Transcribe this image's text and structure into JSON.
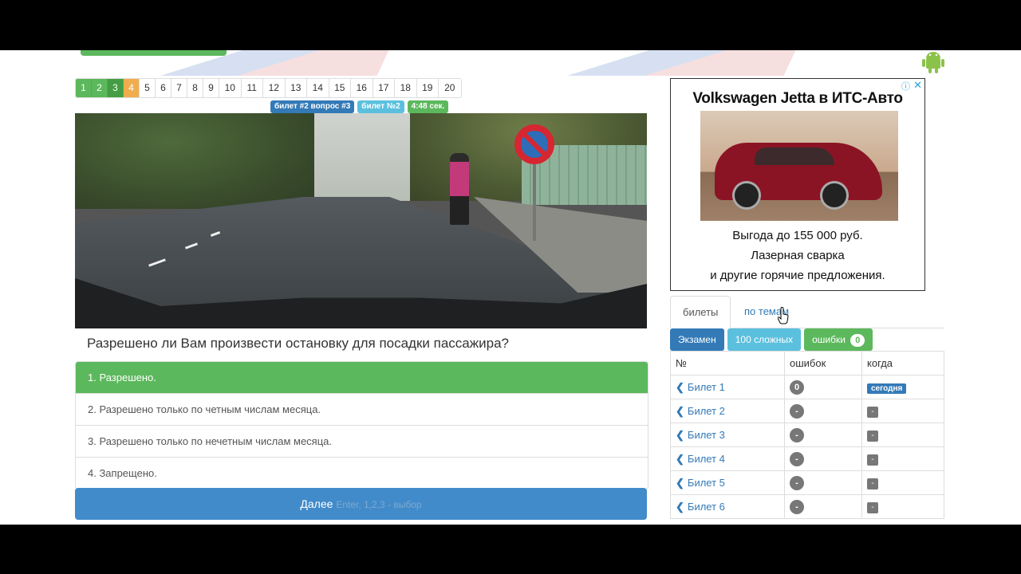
{
  "pagination": {
    "pages": [
      "1",
      "2",
      "3",
      "4",
      "5",
      "6",
      "7",
      "8",
      "9",
      "10",
      "11",
      "12",
      "13",
      "14",
      "15",
      "16",
      "17",
      "18",
      "19",
      "20"
    ],
    "answered": [
      "1",
      "2",
      "3"
    ],
    "current": "4"
  },
  "labels": {
    "ticket_question": "билет #2 вопрос #3",
    "ticket": "билет №2",
    "timer": "4:48 сек."
  },
  "question": "Разрешено ли Вам произвести остановку для посадки пассажира?",
  "answers": [
    "1. Разрешено.",
    "2. Разрешено только по четным числам месяца.",
    "3. Разрешено только по нечетным числам месяца.",
    "4. Запрещено."
  ],
  "next_button": {
    "label": "Далее",
    "hint": "Enter, 1,2,3 - выбор"
  },
  "ad": {
    "title": "Volkswagen Jetta в ИТС-Авто",
    "line1": "Выгода до 155 000 руб.",
    "line2": "Лазерная сварка",
    "line3": "и другие горячие предложения.",
    "close": "✕",
    "info": "ⓘ"
  },
  "tabs": {
    "active": "билеты",
    "other": "по темам"
  },
  "buttons": {
    "exam": "Экзамен",
    "hard": "100 сложных",
    "errors": "ошибки",
    "errors_count": "0"
  },
  "table": {
    "headers": [
      "№",
      "ошибок",
      "когда"
    ],
    "rows": [
      {
        "name": "Билет 1",
        "errors": "0",
        "when": "сегодня"
      },
      {
        "name": "Билет 2",
        "errors": "-",
        "when": "-"
      },
      {
        "name": "Билет 3",
        "errors": "-",
        "when": "-"
      },
      {
        "name": "Билет 4",
        "errors": "-",
        "when": "-"
      },
      {
        "name": "Билет 5",
        "errors": "-",
        "when": "-"
      },
      {
        "name": "Билет 6",
        "errors": "-",
        "when": "-"
      }
    ]
  },
  "colors": {
    "success": "#5cb85c",
    "primary": "#337ab7",
    "warning": "#f0ad4e",
    "info": "#5bc0de"
  }
}
